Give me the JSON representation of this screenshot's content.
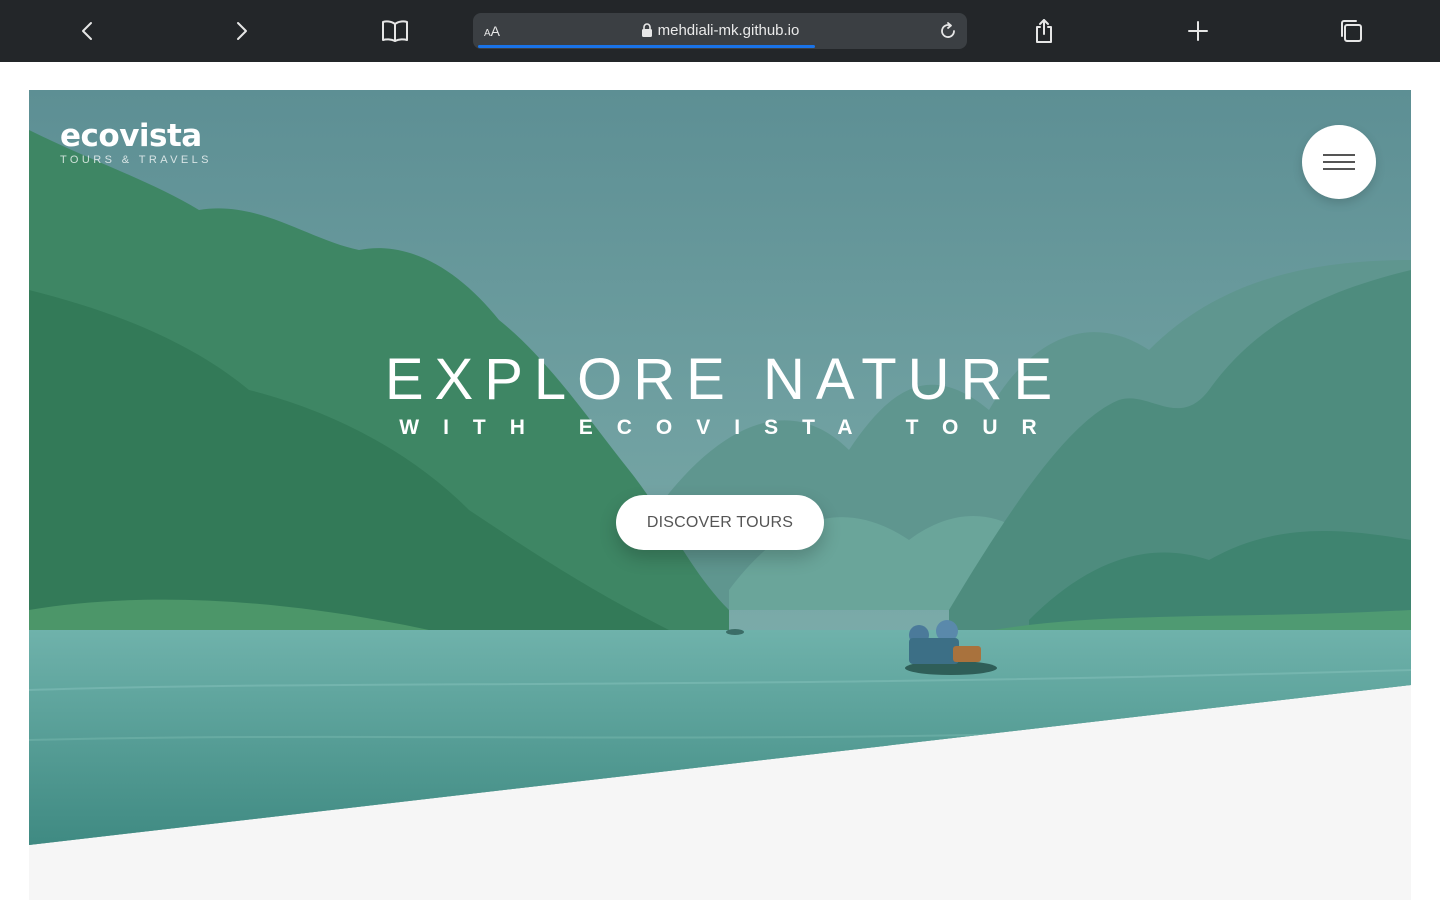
{
  "browser": {
    "aa_label_small": "A",
    "aa_label_large": "A",
    "url": "mehdiali-mk.github.io",
    "load_progress_percent": 70,
    "icons": [
      "back-icon",
      "forward-icon",
      "bookmarks-icon",
      "lock-icon",
      "reload-icon",
      "share-icon",
      "new-tab-icon",
      "tabs-icon"
    ]
  },
  "site": {
    "logo_brand": "ecovista",
    "logo_tagline": "TOURS & TRAVELS",
    "headline_main": "EXPLORE NATURE",
    "headline_sub": "WITH ECOVISTA TOUR",
    "cta_label": "DISCOVER TOURS",
    "menu_icon": "hamburger-menu-icon"
  },
  "colors": {
    "toolbar": "#232629",
    "address_bar": "#3b3f43",
    "progress": "#1a73e8",
    "hero_overlay": "#4d8d7c",
    "section_bg": "#f6f6f6"
  }
}
